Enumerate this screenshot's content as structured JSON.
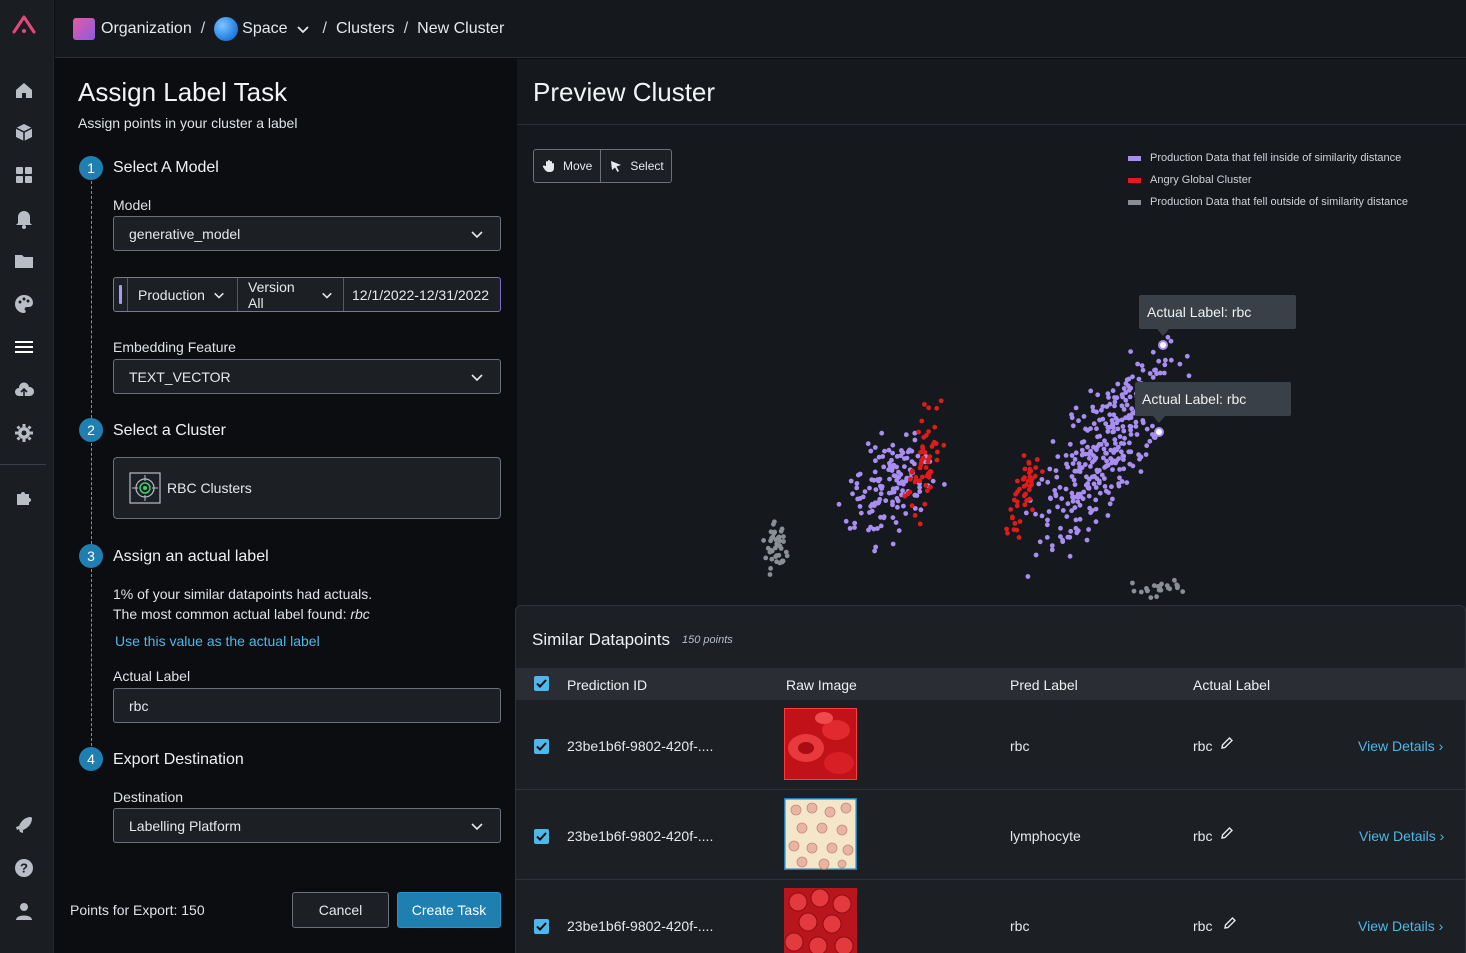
{
  "breadcrumb": {
    "organization": "Organization",
    "space": "Space",
    "clusters": "Clusters",
    "current": "New Cluster",
    "sep": "/"
  },
  "panel": {
    "title": "Assign Label Task",
    "subtitle": "Assign points in your cluster a label",
    "steps": [
      {
        "num": "1",
        "title": "Select A Model"
      },
      {
        "num": "2",
        "title": "Select a Cluster"
      },
      {
        "num": "3",
        "title": "Assign an actual label"
      },
      {
        "num": "4",
        "title": "Export Destination"
      }
    ],
    "model_label": "Model",
    "model_value": "generative_model",
    "environment": "Production",
    "version": "Version All",
    "date_range": "12/1/2022-12/31/2022",
    "embedding_label": "Embedding Feature",
    "embedding_value": "TEXT_VECTOR",
    "cluster_name": "RBC Clusters",
    "actuals_line1": "1% of your similar datapoints had actuals.",
    "actuals_line2_prefix": "The most common actual label found: ",
    "actuals_line2_value": "rbc",
    "use_value_link": "Use this value as the actual label",
    "actual_label_label": "Actual Label",
    "actual_label_value": "rbc",
    "destination_label": "Destination",
    "destination_value": "Labelling Platform",
    "points_for_export": "Points for Export: 150",
    "cancel": "Cancel",
    "create_task": "Create Task"
  },
  "preview": {
    "title": "Preview Cluster",
    "tool_move": "Move",
    "tool_select": "Select",
    "legend": [
      {
        "label": "Production Data that fell inside of similarity distance",
        "color": "#a98ef2"
      },
      {
        "label": "Angry Global Cluster",
        "color": "#e01b1b"
      },
      {
        "label": "Production Data that fell outside of similarity distance",
        "color": "#8a8f96"
      }
    ],
    "tooltip_1": "Actual Label: rbc",
    "tooltip_2": "Actual Label: rbc"
  },
  "similar": {
    "title": "Similar Datapoints",
    "count": "150 points",
    "columns": [
      "Prediction ID",
      "Raw Image",
      "Pred Label",
      "Actual Label"
    ],
    "rows": [
      {
        "id": "23be1b6f-9802-420f-....",
        "pred": "rbc",
        "actual": "rbc",
        "view": "View Details"
      },
      {
        "id": "23be1b6f-9802-420f-....",
        "pred": "lymphocyte",
        "actual": "rbc",
        "view": "View Details"
      },
      {
        "id": "23be1b6f-9802-420f-....",
        "pred": "rbc",
        "actual": "rbc",
        "view": "View Details"
      }
    ]
  },
  "icons": {
    "rail": [
      "logo-icon",
      "home-icon",
      "cube-icon",
      "grid-icon",
      "bell-icon",
      "folder-icon",
      "palette-icon",
      "list-icon",
      "cloud-upload-icon",
      "gear-icon",
      "puzzle-icon",
      "rocket-icon",
      "help-icon",
      "user-icon"
    ]
  }
}
